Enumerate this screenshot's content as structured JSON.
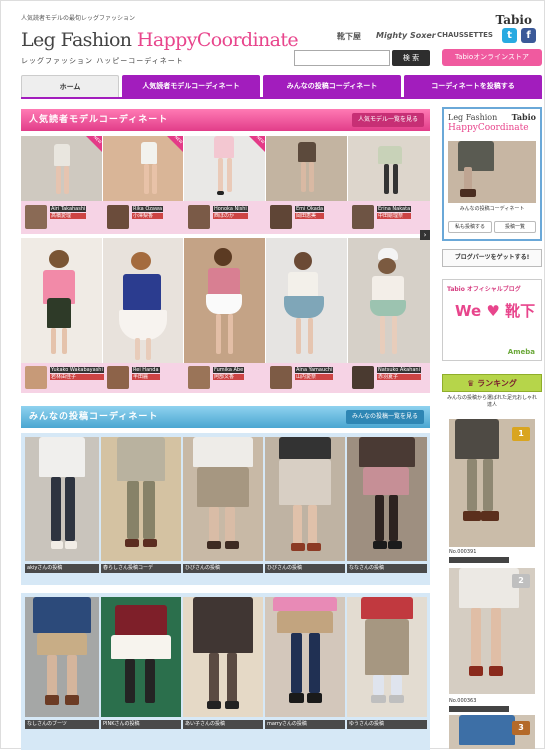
{
  "header": {
    "tagline": "人気読者モデルの最旬レッグファッション",
    "logo_a": "Leg Fashion ",
    "logo_b": "HappyCoordinate",
    "logo_sub": "レッグファッション ハッピーコーディネート",
    "brands": [
      "靴下屋",
      "Mighty Soxer",
      "CHAUSSETTES"
    ],
    "tabio_logo": "Tabio",
    "twitter_glyph": "t",
    "facebook_glyph": "f",
    "search_button": "検 索",
    "search_placeholder": "",
    "store_button": "Tabioオンラインストア"
  },
  "nav": {
    "tabs": [
      {
        "label": "ホーム"
      },
      {
        "label": "人気読者モデルコーディネート"
      },
      {
        "label": "みんなの投稿コーディネート"
      },
      {
        "label": "コーディネートを投稿する"
      }
    ]
  },
  "models_section": {
    "title": "人気読者モデルコーディネート",
    "more": "人気モデル一覧を見る",
    "badge": "NEW",
    "row1": [
      {
        "en": "Airi Takahashi",
        "jp": "高橋愛理"
      },
      {
        "en": "Rika Ozawa",
        "jp": "小澤梨香"
      },
      {
        "en": "Honoka Nishi",
        "jp": "西ほのか"
      },
      {
        "en": "Emi Okada",
        "jp": "岡田恵美"
      },
      {
        "en": "Erina Nakata",
        "jp": "中田絵理奈"
      }
    ],
    "row2": [
      {
        "en": "Yukako Wakabayashi",
        "jp": "若林由佳子"
      },
      {
        "en": "Rei Handa",
        "jp": "半田麗"
      },
      {
        "en": "Fumika Abe",
        "jp": "阿部文香"
      },
      {
        "en": "Aina Yamauchi",
        "jp": "山内愛奈"
      },
      {
        "en": "Natsuko Akahani",
        "jp": "赤羽夏子"
      }
    ]
  },
  "posts_section": {
    "title": "みんなの投稿コーディネート",
    "more": "みんなの投稿一覧を見る",
    "row1": [
      "akiyさんの投稿",
      "春らしさん投稿コーデ",
      "ひびさんの投稿",
      "ひびさんの投稿",
      "ななさんの投稿"
    ],
    "row2": [
      "なしさんのブーツ",
      "PINKさんの投稿",
      "あい子さんの投稿",
      "marryさんの投稿",
      "ゆうさんの投稿"
    ]
  },
  "sidebar": {
    "box_logo_a": "Leg Fashion",
    "box_logo_tabio": "Tabio",
    "box_logo_b": "HappyCoordinate",
    "box_caption": "みんなの投稿コーディネート",
    "btn_post": "私も投稿する",
    "btn_list": "投稿一覧",
    "blog_parts": "ブログパーツをゲットする!",
    "blog_title": "Tabio オフィシャルブログ",
    "blog_text": "We ♥ 靴下",
    "blog_powered": "Ameba",
    "ranking_title": "ランキング",
    "ranking_sub": "みんなの投稿から選ばれた足元おしゃれ達人",
    "rank1_no": "No.000391",
    "rank2_no": "No.000363",
    "rank_nums": [
      "1",
      "2",
      "3"
    ]
  },
  "colors": {
    "accent_pink": "#e8458c",
    "nav_purple": "#a21dbd",
    "section_blue": "#4aa6d1",
    "ranking_green": "#b6d54a"
  }
}
